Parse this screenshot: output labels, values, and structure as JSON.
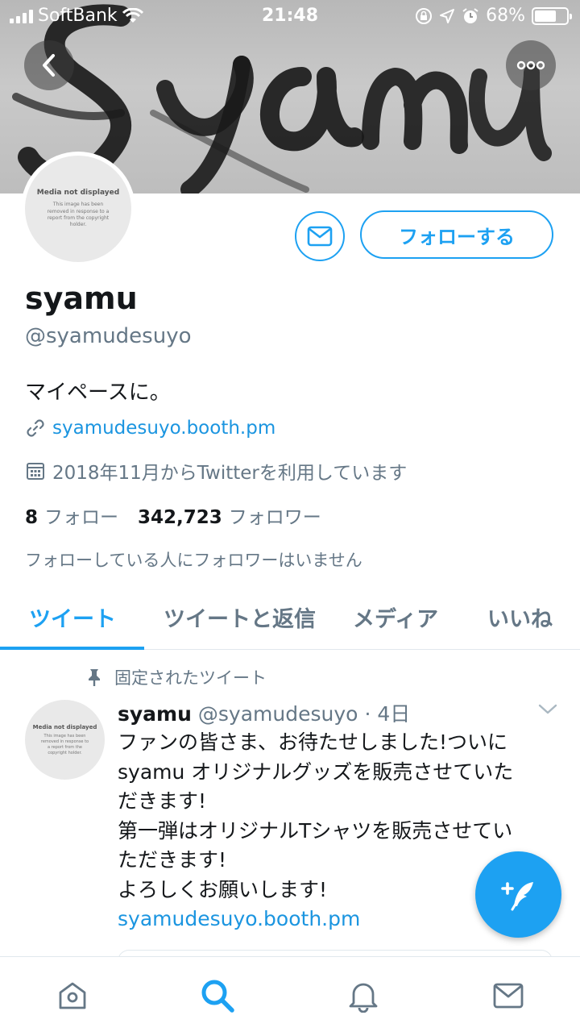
{
  "status_bar": {
    "carrier": "SoftBank",
    "time": "21:48",
    "battery_percent": "68%",
    "battery_level": 0.68
  },
  "profile": {
    "avatar_placeholder": {
      "title": "Media not displayed",
      "text": "This image has been removed in response to a report from the copyright holder."
    },
    "name": "syamu",
    "handle": "@syamudesuyo",
    "bio": "マイペースに。",
    "link": "syamudesuyo.booth.pm",
    "joined": "2018年11月からTwitterを利用しています",
    "following_count": "8",
    "following_label": "フォロー",
    "followers_count": "342,723",
    "followers_label": "フォロワー",
    "followers_note": "フォローしている人にフォロワーはいません",
    "follow_button": "フォローする"
  },
  "tabs": [
    {
      "label": "ツイート",
      "active": true
    },
    {
      "label": "ツイートと返信",
      "active": false
    },
    {
      "label": "メディア",
      "active": false
    },
    {
      "label": "いいね",
      "active": false
    }
  ],
  "tweet": {
    "pinned_label": "固定されたツイート",
    "name": "syamu",
    "handle": "@syamudesuyo",
    "time": "· 4日",
    "lines": [
      "ファンの皆さま、お待たせしました!ついに",
      "syamu オリジナルグッズを販売させていた",
      "だきます!",
      "第一弾はオリジナルTシャツを販売させてい",
      "ただきます!",
      "よろしくお願いします!"
    ],
    "link": "syamudesuyo.booth.pm"
  },
  "colors": {
    "accent": "#1da1f2",
    "link": "#1b95e0",
    "secondary_text": "#657786"
  },
  "icons": {
    "back": "chevron-left-icon",
    "more": "more-icon",
    "message": "envelope-icon",
    "link": "link-icon",
    "calendar": "calendar-icon",
    "pin": "pin-icon",
    "compose": "compose-icon",
    "home": "home-icon",
    "search": "search-icon",
    "notifications": "bell-icon",
    "messages": "envelope-icon"
  }
}
